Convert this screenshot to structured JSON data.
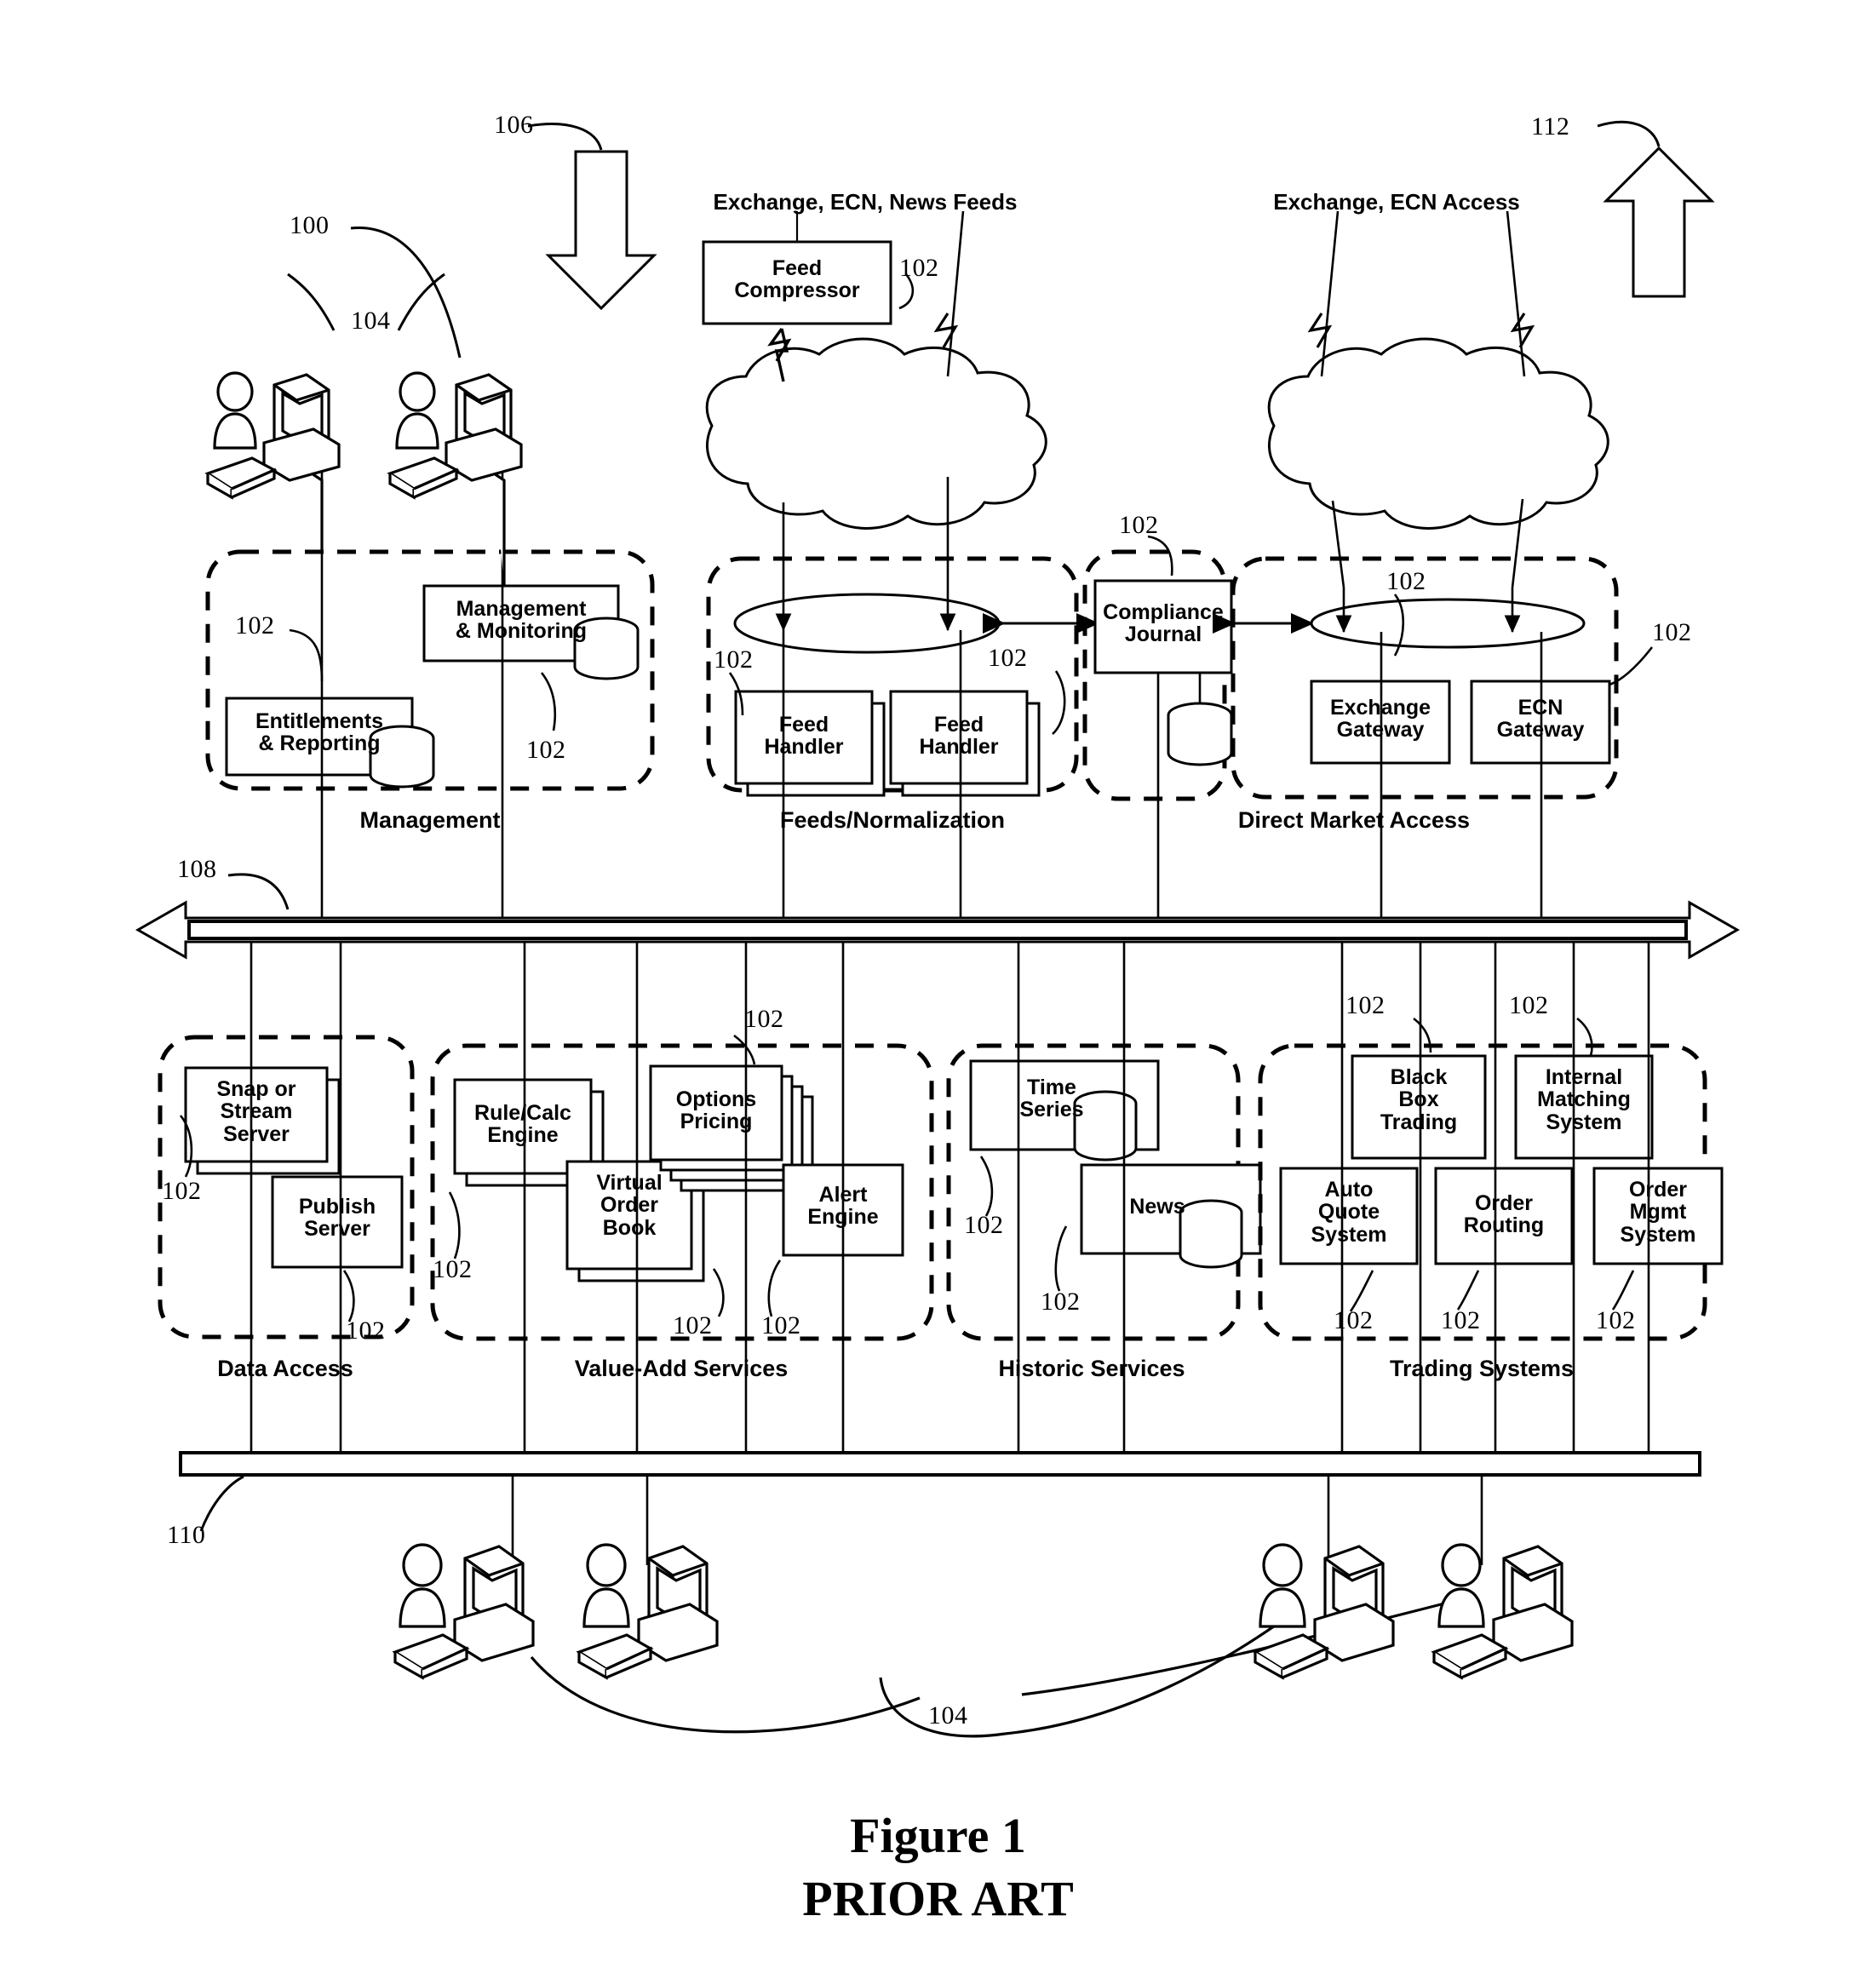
{
  "figure": {
    "caption_line1": "Figure 1",
    "caption_line2": "PRIOR ART"
  },
  "top_labels": {
    "feeds_source": "Exchange, ECN, News Feeds",
    "market_access": "Exchange, ECN Access"
  },
  "reference_numerals": {
    "system": "100",
    "component": "102",
    "user": "104",
    "inbound_arrow": "106",
    "upper_bus": "108",
    "lower_bus": "110",
    "outbound_arrow": "112"
  },
  "nodes": {
    "feed_compressor": "Feed\nCompressor",
    "entitlements_reporting": "Entitlements\n& Reporting",
    "management_monitoring": "Management\n& Monitoring",
    "feed_handler_1": "Feed\nHandler",
    "feed_handler_2": "Feed\nHandler",
    "compliance_journal": "Compliance\nJournal",
    "exchange_gateway": "Exchange\nGateway",
    "ecn_gateway": "ECN\nGateway",
    "snap_or_stream_server": "Snap or\nStream\nServer",
    "publish_server": "Publish\nServer",
    "rule_calc_engine": "Rule/Calc\nEngine",
    "virtual_order_book": "Virtual\nOrder\nBook",
    "options_pricing": "Options\nPricing",
    "alert_engine": "Alert\nEngine",
    "time_series": "Time\nSeries",
    "news": "News",
    "black_box_trading": "Black\nBox\nTrading",
    "internal_matching_system": "Internal\nMatching\nSystem",
    "auto_quote_system": "Auto\nQuote\nSystem",
    "order_routing": "Order\nRouting",
    "order_mgmt_system": "Order\nMgmt\nSystem"
  },
  "group_labels": {
    "management": "Management",
    "feeds_normalization": "Feeds/Normalization",
    "direct_market_access": "Direct Market Access",
    "data_access": "Data Access",
    "value_add_services": "Value-Add Services",
    "historic_services": "Historic Services",
    "trading_systems": "Trading Systems"
  },
  "colors": {
    "stroke": "#000000",
    "background": "#ffffff"
  }
}
